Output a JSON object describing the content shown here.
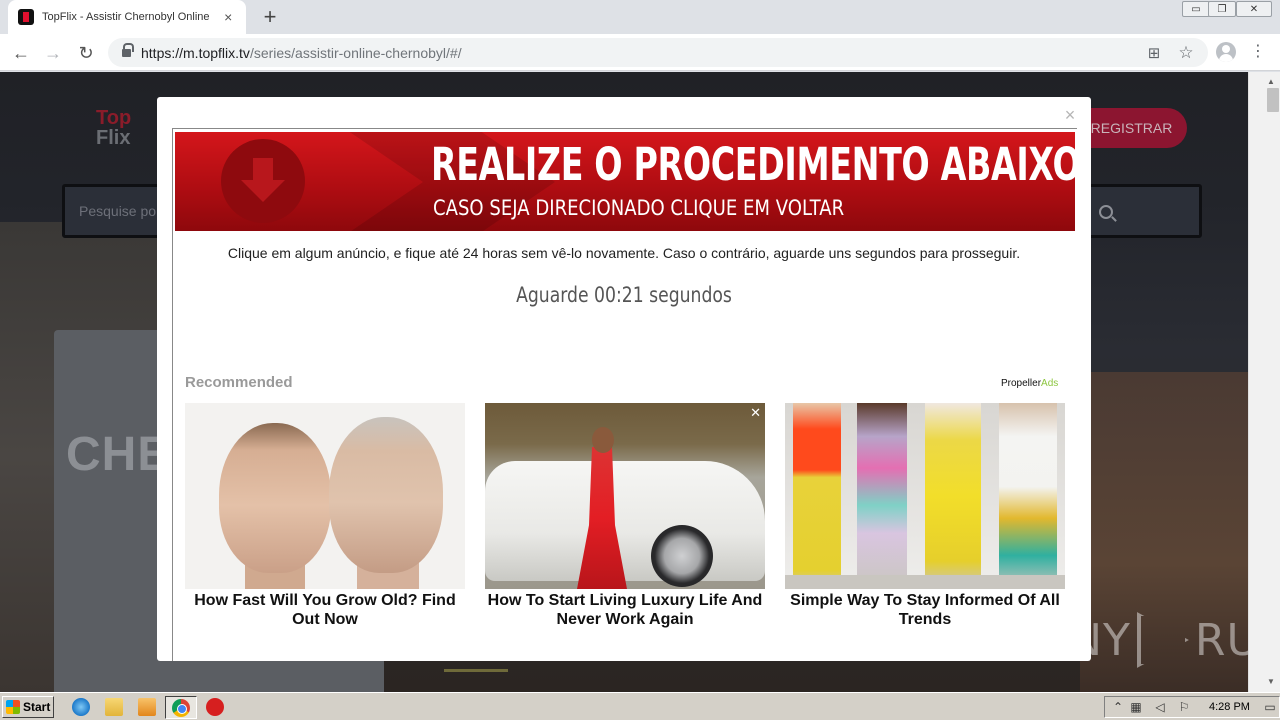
{
  "browser": {
    "tab_title": "TopFlix - Assistir Chernobyl Online D",
    "tab_close": "×",
    "new_tab": "+",
    "url_host": "https://m.topflix.tv",
    "url_path": "/series/assistir-online-chernobyl/#/",
    "win_minimize": "▭",
    "win_restore": "❐",
    "win_close": "✕"
  },
  "site": {
    "logo_top": "Top",
    "logo_bottom": "Flix",
    "register_label": "REGISTRAR",
    "search_placeholder": "Pesquise po",
    "poster_text": "CHE"
  },
  "modal": {
    "close_label": "×",
    "banner_title": "REALIZE O PROCEDIMENTO ABAIXO",
    "banner_subtitle": "CASO SEJA DIRECIONADO CLIQUE EM VOLTAR",
    "notice": "Clique em algum anúncio, e fique até 24 horas sem vê-lo novamente. Caso o contrário, aguarde uns segundos para prosseguir.",
    "countdown": "Aguarde 00:21 segundos",
    "recommended_label": "Recommended",
    "ads_brand_main": "Propeller",
    "ads_brand_suffix": "Ads",
    "cards": [
      {
        "caption": "How Fast Will You Grow Old? Find Out Now"
      },
      {
        "caption": "How To Start Living Luxury Life And Never Work Again",
        "close": "✕"
      },
      {
        "caption": "Simple Way To Stay Informed Of All Trends"
      }
    ]
  },
  "watermark": {
    "left": "ANY",
    "right": "RUN"
  },
  "taskbar": {
    "start_label": "Start",
    "clock": "4:28 PM"
  },
  "icons": {
    "back": "←",
    "forward": "→",
    "reload": "↻",
    "translate": "⊞",
    "star": "☆",
    "menu": "⋮",
    "scroll_up": "▲",
    "scroll_down": "▼"
  }
}
